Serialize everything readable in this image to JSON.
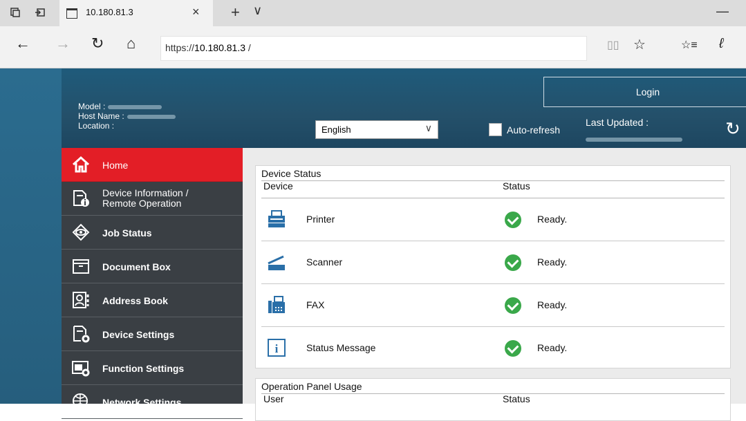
{
  "browser": {
    "tab_title": "10.180.81.3",
    "tab_close": "×",
    "new_tab": "+",
    "tab_dropdown": "∨",
    "minimize": "—",
    "back": "←",
    "forward": "→",
    "refresh": "↻",
    "home": "⌂",
    "url_prefix": "https://",
    "url_host": "10.180.81.3",
    "url_suffix": " /",
    "reading_view": "📖",
    "favorite": "☆",
    "favorites_hub": "☆≡",
    "notes": "ℓ"
  },
  "header": {
    "model_label": "Model :",
    "host_label": "Host Name :",
    "location_label": "Location :",
    "language_value": "English",
    "language_arrow": "∨",
    "auto_refresh_label": "Auto-refresh",
    "last_updated_label": "Last Updated :",
    "login_label": "Login",
    "refresh_icon": "↻"
  },
  "sidebar": {
    "items": [
      {
        "label": "Home",
        "icon": "home-icon"
      },
      {
        "label_line1": "Device Information /",
        "label_line2": "Remote Operation",
        "icon": "device-info-icon"
      },
      {
        "label": "Job Status",
        "icon": "eye-icon"
      },
      {
        "label": "Document Box",
        "icon": "box-icon"
      },
      {
        "label": "Address Book",
        "icon": "address-book-icon"
      },
      {
        "label": "Device Settings",
        "icon": "device-settings-icon"
      },
      {
        "label": "Function Settings",
        "icon": "function-settings-icon"
      },
      {
        "label": "Network Settings",
        "icon": "network-icon"
      }
    ]
  },
  "device_status": {
    "title": "Device Status",
    "col_device": "Device",
    "col_status": "Status",
    "rows": [
      {
        "device": "Printer",
        "status": "Ready.",
        "icon": "printer-icon"
      },
      {
        "device": "Scanner",
        "status": "Ready.",
        "icon": "scanner-icon"
      },
      {
        "device": "FAX",
        "status": "Ready.",
        "icon": "fax-icon"
      },
      {
        "device": "Status Message",
        "status": "Ready.",
        "icon": "info-icon"
      }
    ]
  },
  "operation_panel": {
    "title": "Operation Panel Usage",
    "col_user": "User",
    "col_status": "Status"
  },
  "colors": {
    "header_bg": "#1f5b7b",
    "sidebar_bg": "#3a3f44",
    "active_item": "#e31e26",
    "ok_green": "#3aa84a"
  }
}
